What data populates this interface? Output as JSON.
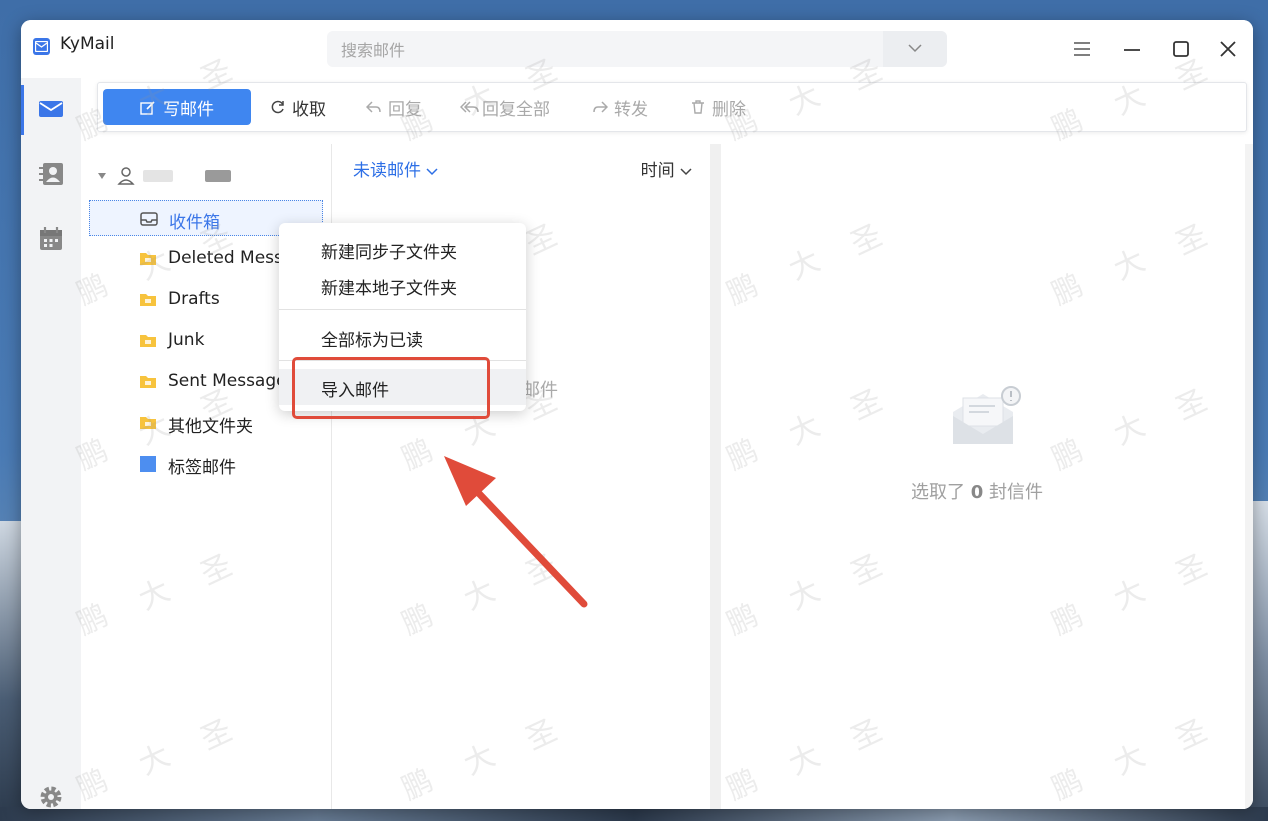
{
  "app": {
    "title": "KyMail"
  },
  "search": {
    "placeholder": "搜索邮件"
  },
  "toolbar": {
    "compose_label": "写邮件",
    "receive_label": "收取",
    "reply_label": "回复",
    "reply_all_label": "回复全部",
    "forward_label": "转发",
    "delete_label": "删除"
  },
  "folders": {
    "inbox": "收件箱",
    "deleted": "Deleted Messages",
    "drafts": "Drafts",
    "junk": "Junk",
    "sent": "Sent Messages",
    "other": "其他文件夹",
    "tags": "标签邮件"
  },
  "list": {
    "filter_label": "未读邮件",
    "sort_label": "时间",
    "empty_text": "邮件"
  },
  "preview": {
    "empty_prefix": "选取了",
    "empty_count": "0",
    "empty_suffix": "封信件"
  },
  "context_menu": {
    "items": [
      "新建同步子文件夹",
      "新建本地子文件夹",
      "全部标为已读",
      "导入邮件"
    ]
  },
  "watermark": [
    "鹏",
    "大",
    "圣"
  ],
  "colors": {
    "accent": "#3b76e8",
    "compose_button": "#3f86f0",
    "highlight": "#e04b3a",
    "folder_icon": "#f7c33d"
  }
}
